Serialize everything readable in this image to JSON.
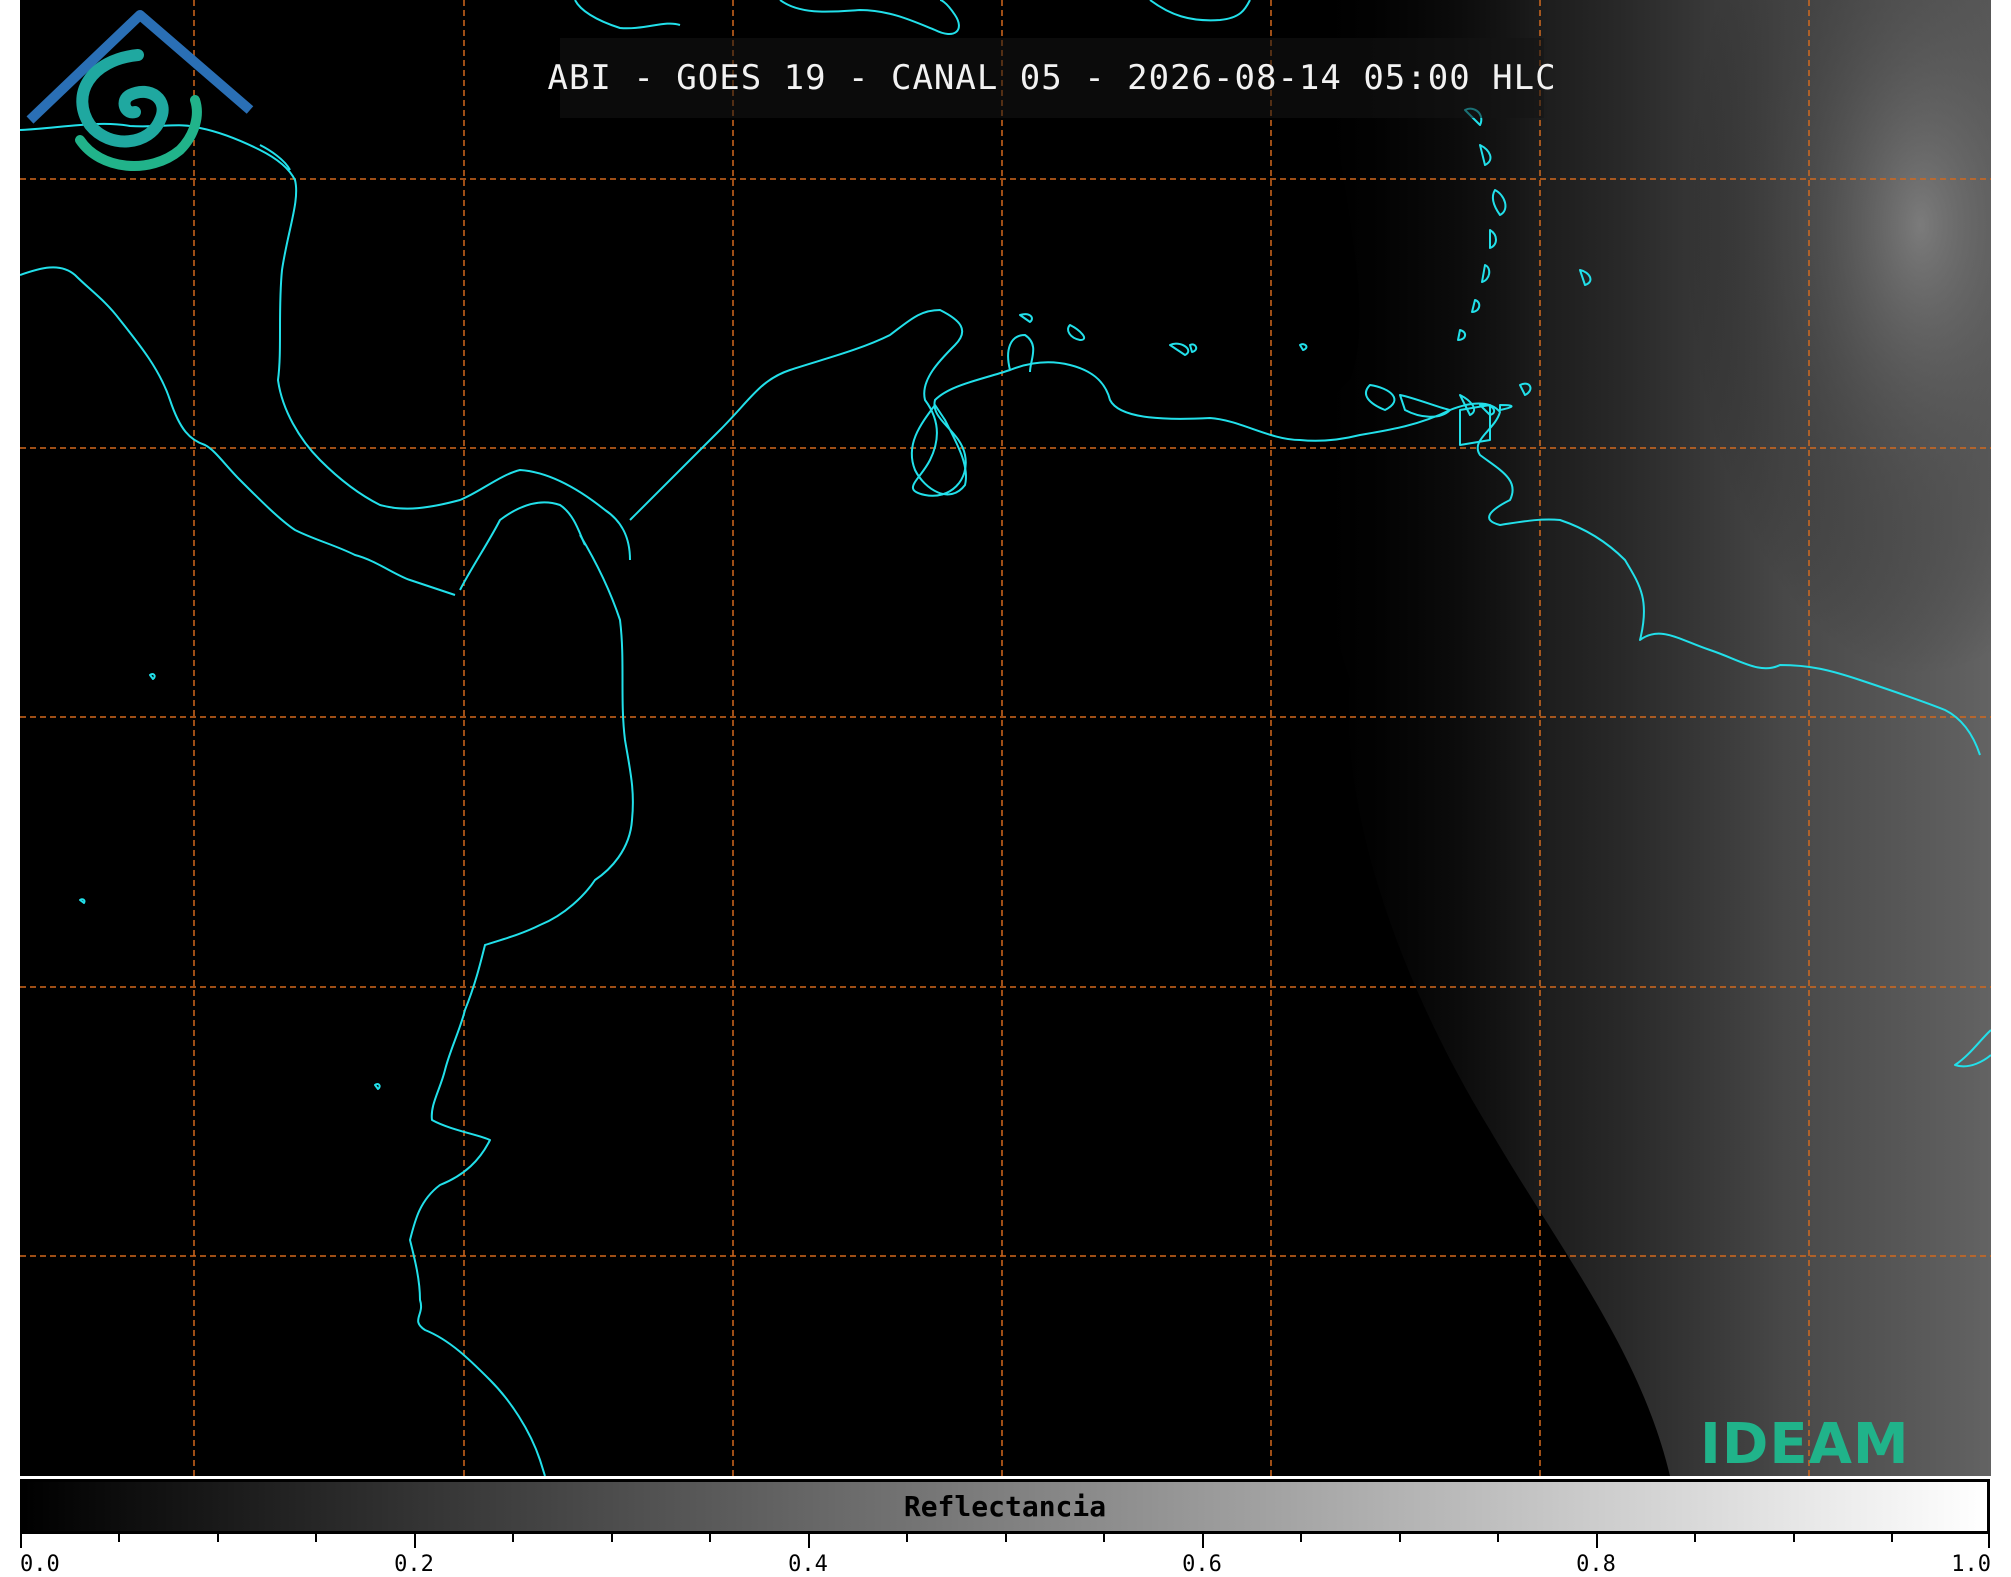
{
  "title": "ABI - GOES 19 - CANAL 05 - 2026-08-14 05:00 HLC",
  "colorbar": {
    "label": "Reflectancia",
    "range": [
      0.0,
      1.0
    ],
    "ticks": [
      "0.0",
      "0.2",
      "0.4",
      "0.6",
      "0.8",
      "1.0"
    ],
    "gradient_start": "#000000",
    "gradient_end": "#ffffff"
  },
  "logo": {
    "text": "IDEAM",
    "color_text": "#20b38a",
    "color_roof": "#2a6fb5",
    "color_swirl": "#1fa8a0"
  },
  "colors": {
    "coastline": "#22e0ea",
    "gridlines": "#d2691e",
    "background": "#000000"
  }
}
